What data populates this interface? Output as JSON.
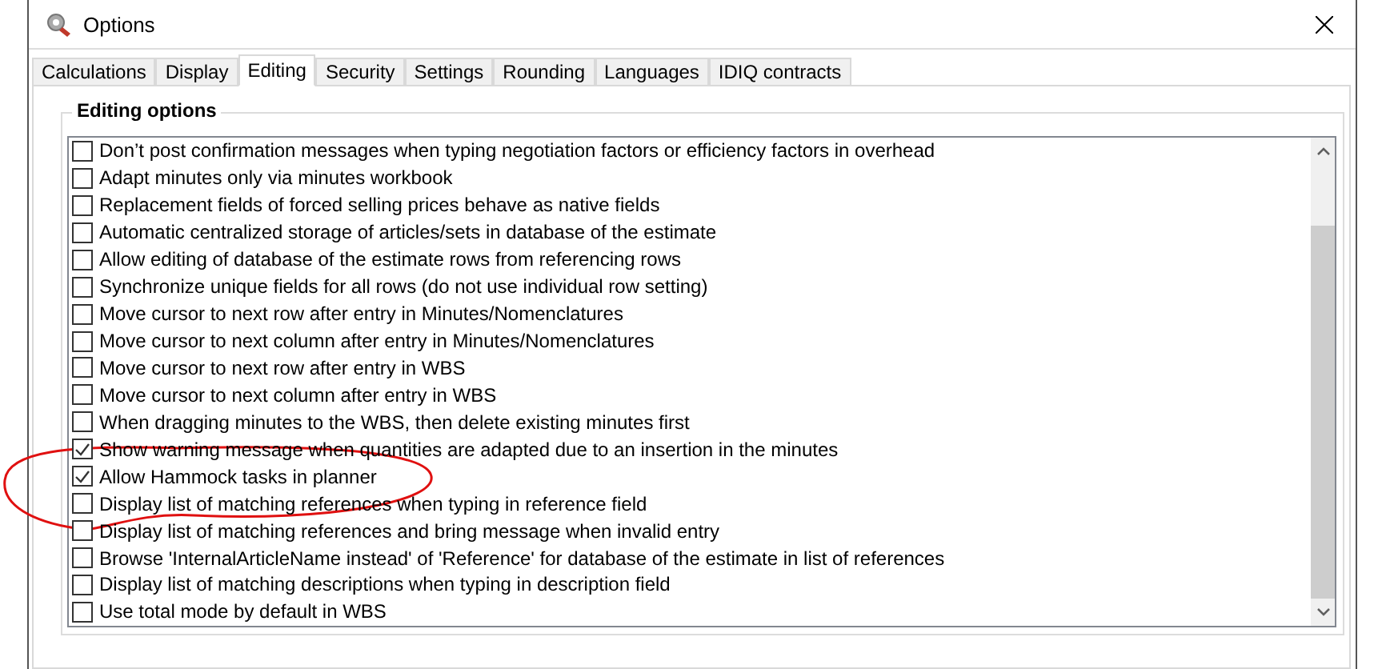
{
  "window": {
    "title": "Options"
  },
  "tabs": [
    {
      "label": "Calculations",
      "selected": false
    },
    {
      "label": "Display",
      "selected": false
    },
    {
      "label": "Editing",
      "selected": true
    },
    {
      "label": "Security",
      "selected": false
    },
    {
      "label": "Settings",
      "selected": false
    },
    {
      "label": "Rounding",
      "selected": false
    },
    {
      "label": "Languages",
      "selected": false
    },
    {
      "label": "IDIQ contracts",
      "selected": false
    }
  ],
  "group": {
    "title": "Editing options"
  },
  "options": [
    {
      "label": "Don’t post confirmation messages when typing negotiation factors or efficiency factors in overhead",
      "checked": false
    },
    {
      "label": "Adapt minutes only via minutes workbook",
      "checked": false
    },
    {
      "label": "Replacement fields of forced selling prices behave as native fields",
      "checked": false
    },
    {
      "label": "Automatic centralized storage of articles/sets in database of the estimate",
      "checked": false
    },
    {
      "label": "Allow editing of database of the estimate rows from referencing rows",
      "checked": false
    },
    {
      "label": "Synchronize unique fields for all rows (do not use individual row setting)",
      "checked": false
    },
    {
      "label": "Move cursor to next row after entry in Minutes/Nomenclatures",
      "checked": false
    },
    {
      "label": "Move cursor to next column after entry in Minutes/Nomenclatures",
      "checked": false
    },
    {
      "label": "Move cursor to next row after entry in WBS",
      "checked": false
    },
    {
      "label": "Move cursor to next column after entry in WBS",
      "checked": false
    },
    {
      "label": "When dragging minutes to the WBS, then delete existing minutes first",
      "checked": false
    },
    {
      "label": "Show warning message when quantities are adapted due to an insertion in the minutes",
      "checked": true
    },
    {
      "label": "Allow Hammock tasks in planner",
      "checked": true
    },
    {
      "label": "Display list of matching references when typing in reference field",
      "checked": false
    },
    {
      "label": "Display list of matching references and bring message when invalid entry",
      "checked": false
    },
    {
      "label": "Browse 'InternalArticleName instead' of 'Reference' for database of the estimate in list of references",
      "checked": false
    },
    {
      "label": "Display list of matching descriptions when typing in description field",
      "checked": false
    },
    {
      "label": "Use total mode by default in WBS",
      "checked": false
    }
  ]
}
